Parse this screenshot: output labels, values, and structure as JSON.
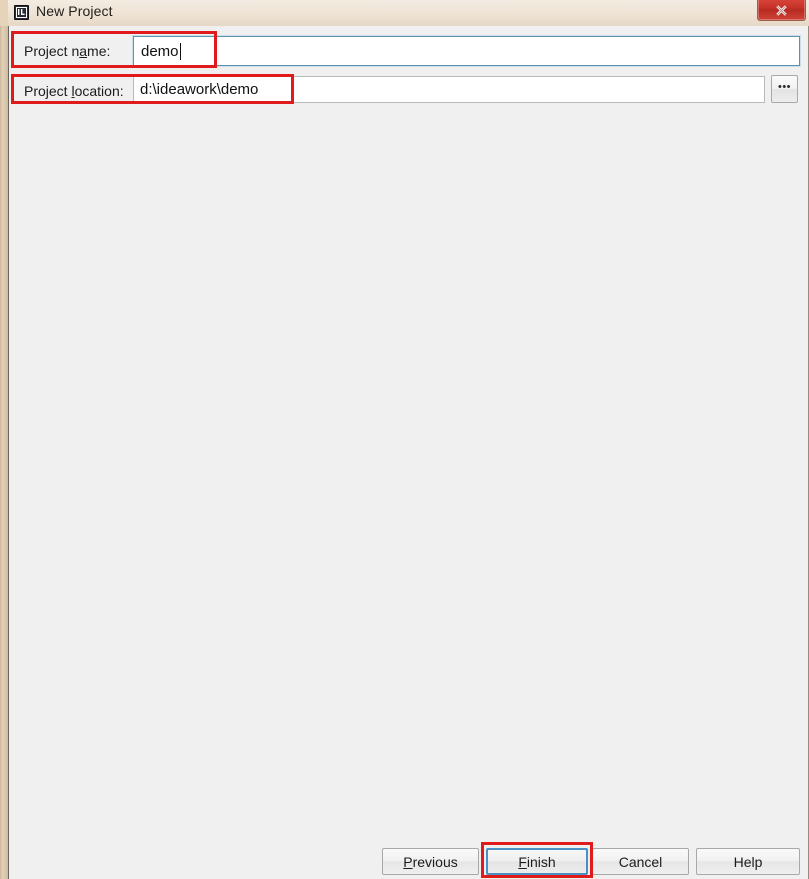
{
  "window": {
    "title": "New Project",
    "icon": "intellij-idea-icon",
    "close_label": "✕"
  },
  "form": {
    "name_field": {
      "label_before": "Project n",
      "label_mnemonic": "a",
      "label_after": "me:",
      "label_full": "Project name:",
      "value": "demo",
      "placeholder": ""
    },
    "location_field": {
      "label_before": "Project ",
      "label_mnemonic": "l",
      "label_after": "ocation:",
      "label_full": "Project location:",
      "value": "d:\\ideawork\\demo",
      "placeholder": "",
      "browse_label": "•••"
    }
  },
  "footer": {
    "buttons": [
      {
        "id": "previous",
        "before": "",
        "mnemonic": "P",
        "after": "revious",
        "label": "Previous"
      },
      {
        "id": "finish",
        "before": "",
        "mnemonic": "F",
        "after": "inish",
        "label": "Finish"
      },
      {
        "id": "cancel",
        "before": "",
        "mnemonic": "",
        "after": "Cancel",
        "label": "Cancel"
      },
      {
        "id": "help",
        "before": "",
        "mnemonic": "",
        "after": "Help",
        "label": "Help"
      }
    ]
  },
  "annotations": {
    "color": "#e01b1b",
    "targets": [
      "project-name-row",
      "project-location-row",
      "finish-button"
    ]
  },
  "colors": {
    "dialog_background": "#f0f0f0",
    "titlebar": "#eee3d4",
    "focus_border": "#5d93ae",
    "annotation_red": "#e01b1b",
    "close_button_red": "#c9342a"
  }
}
